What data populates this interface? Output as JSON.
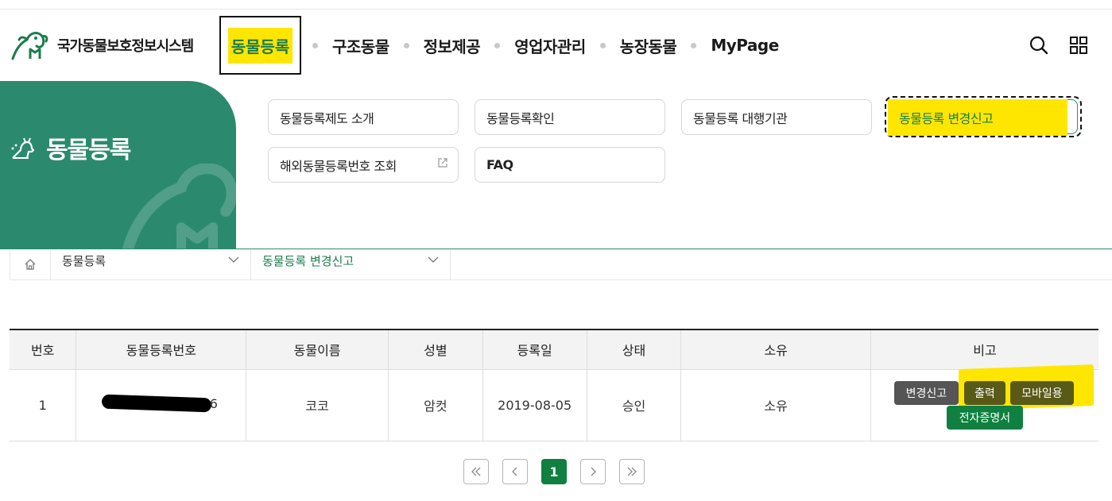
{
  "header": {
    "logo_text": "국가동물보호정보시스템",
    "nav": [
      {
        "label": "동물등록"
      },
      {
        "label": "구조동물"
      },
      {
        "label": "정보제공"
      },
      {
        "label": "영업자관리"
      },
      {
        "label": "농장동물"
      },
      {
        "label": "MyPage"
      }
    ],
    "search_icon": "search-icon",
    "menu_icon": "grid-menu-icon"
  },
  "panel": {
    "title": "동물등록",
    "submenu": [
      {
        "label": "동물등록제도 소개"
      },
      {
        "label": "동물등록확인"
      },
      {
        "label": "동물등록 대행기관"
      },
      {
        "label": "동물등록 변경신고"
      },
      {
        "label": "해외동물등록번호 조회"
      },
      {
        "label": "FAQ"
      }
    ]
  },
  "breadcrumb": {
    "level1": "동물등록",
    "level2": "동물등록 변경신고"
  },
  "table": {
    "headers": [
      "번호",
      "동물등록번호",
      "동물이름",
      "성별",
      "등록일",
      "상태",
      "소유",
      "비고"
    ],
    "rows": [
      {
        "no": "1",
        "reg_no_suffix": "6",
        "name": "코코",
        "sex": "암컷",
        "date": "2019-08-05",
        "status": "승인",
        "owner": "소유",
        "actions": {
          "change": "변경신고",
          "print": "출력",
          "mobile": "모바일용",
          "cert": "전자증명서"
        }
      }
    ]
  },
  "pagination": {
    "current": "1"
  },
  "colors": {
    "brand_green": "#2b8a6e",
    "button_green": "#0f8040",
    "highlight_yellow": "#ffe600"
  }
}
